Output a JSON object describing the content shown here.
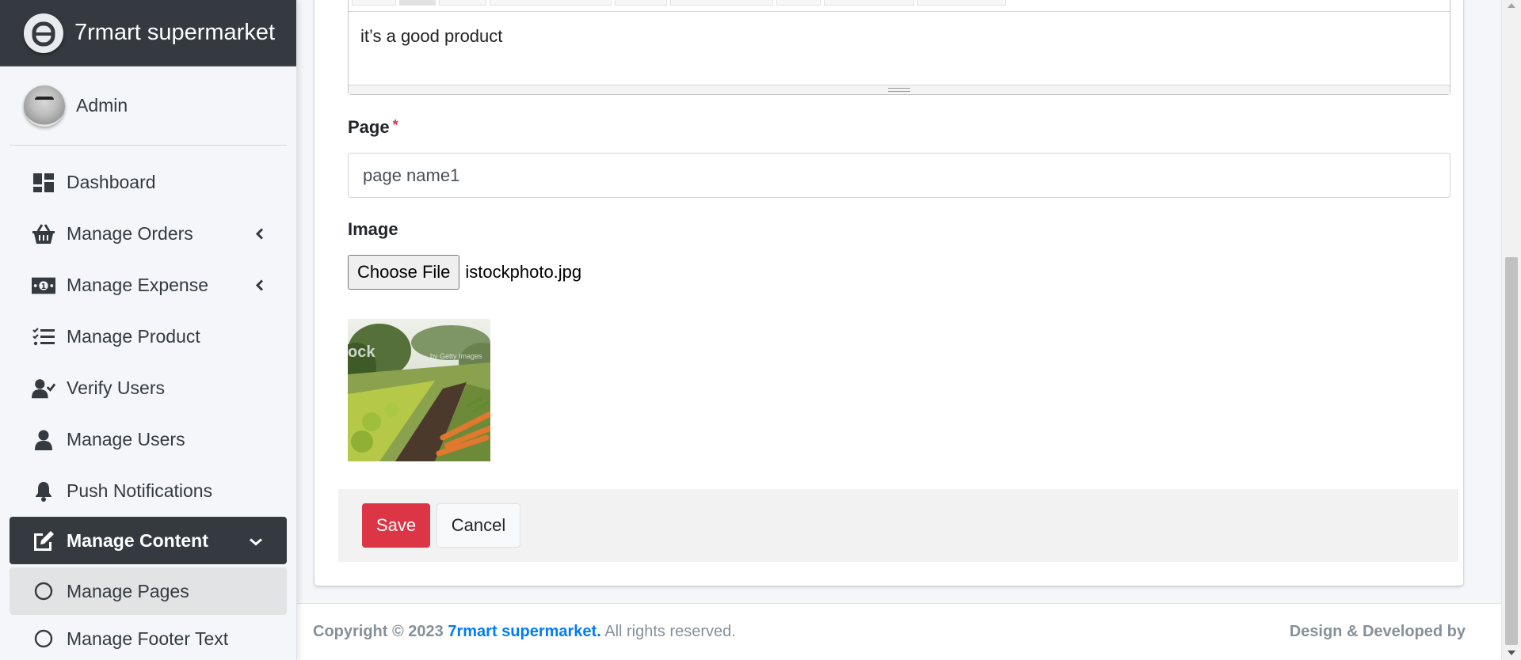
{
  "brand": {
    "name": "7rmart supermarket",
    "logo_icon": "app-logo-icon"
  },
  "user": {
    "name": "Admin"
  },
  "sidebar": {
    "items": [
      {
        "label": "Dashboard",
        "icon": "dashboard-icon",
        "has_caret": false
      },
      {
        "label": "Manage Orders",
        "icon": "basket-icon",
        "has_caret": true
      },
      {
        "label": "Manage Expense",
        "icon": "money-icon",
        "has_caret": true
      },
      {
        "label": "Manage Product",
        "icon": "tasks-icon",
        "has_caret": false
      },
      {
        "label": "Verify Users",
        "icon": "user-check-icon",
        "has_caret": false
      },
      {
        "label": "Manage Users",
        "icon": "user-icon",
        "has_caret": false
      },
      {
        "label": "Push Notifications",
        "icon": "bell-icon",
        "has_caret": false
      },
      {
        "label": "Manage Content",
        "icon": "edit-icon",
        "has_caret": true,
        "active": true
      },
      {
        "label": "Manage Pages",
        "icon": "circle-icon",
        "sub": true,
        "active": true
      },
      {
        "label": "Manage Footer Text",
        "icon": "circle-icon",
        "sub": true
      }
    ]
  },
  "form": {
    "editor_text": "it’s a good product",
    "page_label": "Page",
    "page_required_mark": "*",
    "page_value": "page name1",
    "image_label": "Image",
    "file_button": "Choose File",
    "file_name": "istockphoto.jpg",
    "save_label": "Save",
    "cancel_label": "Cancel"
  },
  "footer": {
    "copyright_prefix": "Copyright © 2023",
    "brand_link": "7rmart supermarket.",
    "rights": "All rights reserved.",
    "credit": "Design & Developed by"
  },
  "colors": {
    "sidebar_dark": "#343a40",
    "danger": "#dc3545",
    "link": "#007bff"
  }
}
